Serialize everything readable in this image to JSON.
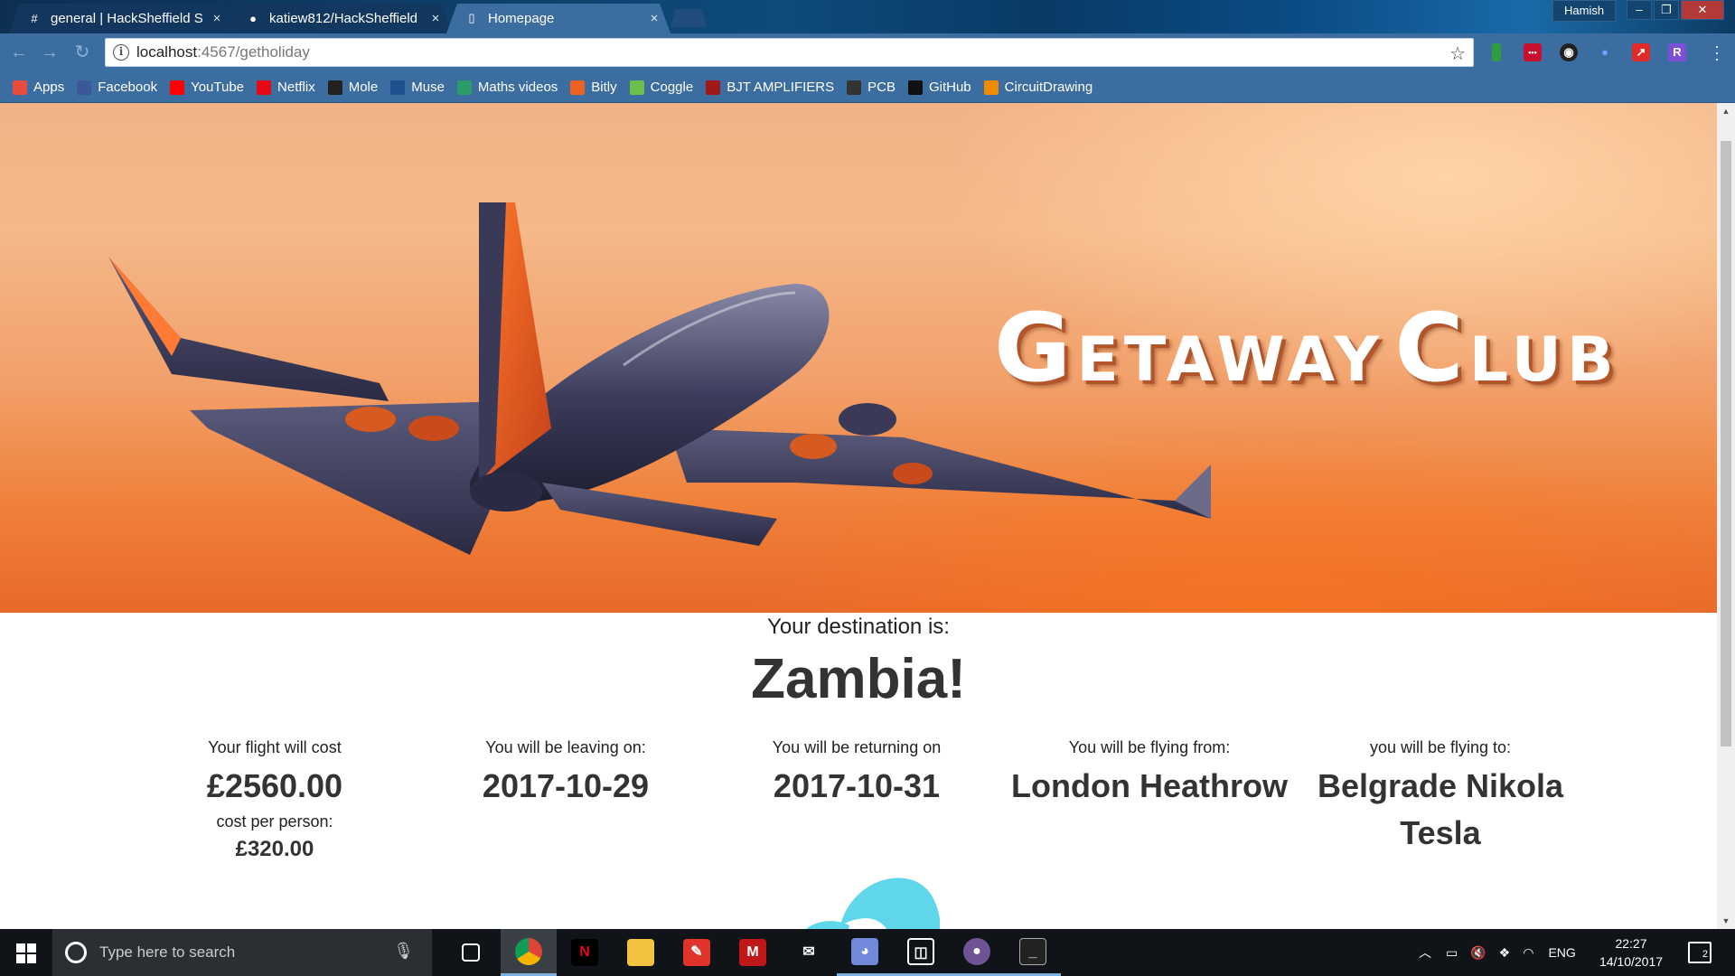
{
  "browser": {
    "tabs": [
      {
        "icon": "#",
        "title": "general | HackSheffield S",
        "active": false
      },
      {
        "icon": "github",
        "title": "katiew812/HackSheffield",
        "active": false
      },
      {
        "icon": "page",
        "title": "Homepage",
        "active": true
      }
    ],
    "profile": "Hamish",
    "url_host": "localhost",
    "url_path": ":4567/getholiday",
    "bookmarks": [
      {
        "label": "Apps",
        "icon": "apps-icon",
        "color": "#e94b3c"
      },
      {
        "label": "Facebook",
        "icon": "facebook-icon",
        "color": "#3b5998"
      },
      {
        "label": "YouTube",
        "icon": "youtube-icon",
        "color": "#ff0000"
      },
      {
        "label": "Netflix",
        "icon": "netflix-icon",
        "color": "#e50914"
      },
      {
        "label": "Mole",
        "icon": "mole-icon",
        "color": "#222222"
      },
      {
        "label": "Muse",
        "icon": "muse-icon",
        "color": "#1f4f8f"
      },
      {
        "label": "Maths videos",
        "icon": "maths-icon",
        "color": "#2e9b6b"
      },
      {
        "label": "Bitly",
        "icon": "bitly-icon",
        "color": "#ee6123"
      },
      {
        "label": "Coggle",
        "icon": "coggle-icon",
        "color": "#6cc04a"
      },
      {
        "label": "BJT AMPLIFIERS",
        "icon": "bjt-icon",
        "color": "#a01818"
      },
      {
        "label": "PCB",
        "icon": "gear-icon",
        "color": "#333333"
      },
      {
        "label": "GitHub",
        "icon": "github-icon",
        "color": "#111111"
      },
      {
        "label": "CircuitDrawing",
        "icon": "circuit-icon",
        "color": "#f08a00"
      }
    ]
  },
  "page": {
    "brand_big1": "G",
    "brand_small1": "ETAWAY",
    "brand_big2": "C",
    "brand_small2": "LUB",
    "destination_label": "Your destination is:",
    "destination": "Zambia!",
    "columns": [
      {
        "label": "Your flight will cost",
        "value": "£2560.00",
        "sublabel": "cost per person:",
        "subvalue": "£320.00"
      },
      {
        "label": "You will be leaving on:",
        "value": "2017-10-29"
      },
      {
        "label": "You will be returning on",
        "value": "2017-10-31"
      },
      {
        "label": "You will be flying from:",
        "value": "London Heathrow"
      },
      {
        "label": "you will be flying to:",
        "value": "Belgrade Nikola Tesla"
      }
    ]
  },
  "taskbar": {
    "search_placeholder": "Type here to search",
    "language": "ENG",
    "time": "22:27",
    "date": "14/10/2017",
    "notifications": "2"
  }
}
